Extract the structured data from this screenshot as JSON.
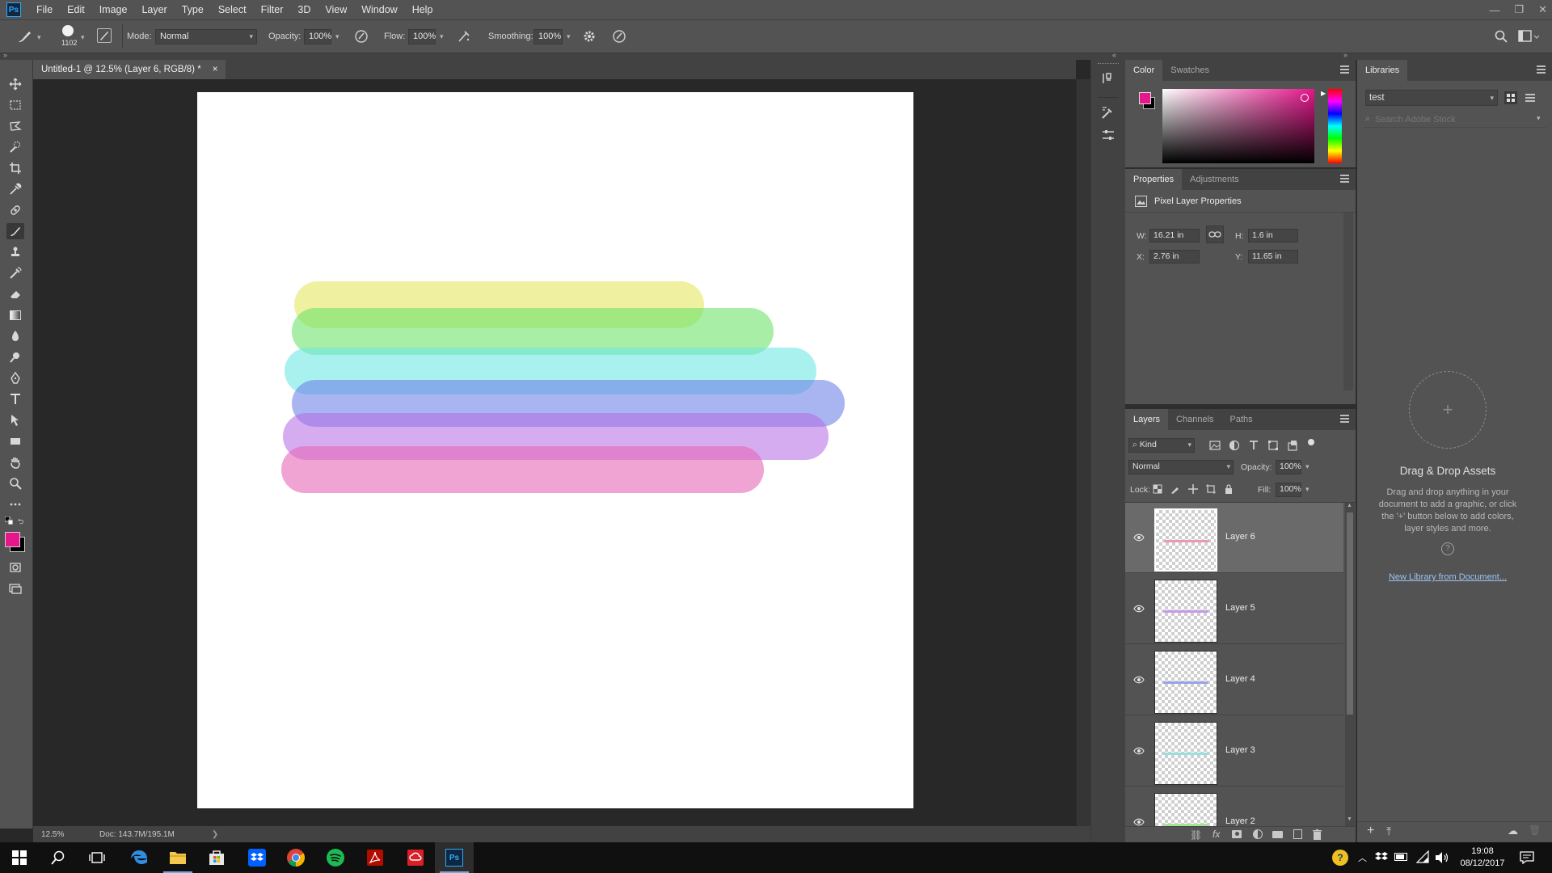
{
  "app": {
    "logo_text": "Ps"
  },
  "menu": [
    "File",
    "Edit",
    "Image",
    "Layer",
    "Type",
    "Select",
    "Filter",
    "3D",
    "View",
    "Window",
    "Help"
  ],
  "options_bar": {
    "brush_size": "1102",
    "mode_label": "Mode:",
    "mode_value": "Normal",
    "opacity_label": "Opacity:",
    "opacity_value": "100%",
    "flow_label": "Flow:",
    "flow_value": "100%",
    "smoothing_label": "Smoothing:",
    "smoothing_value": "100%"
  },
  "document": {
    "tab_title": "Untitled-1 @ 12.5% (Layer 6, RGB/8) *",
    "close_glyph": "×",
    "zoom": "12.5%",
    "doc_info": "Doc: 143.7M/195.1M",
    "strokes": [
      {
        "color": "#e6ea6e",
        "opacity": 0.65
      },
      {
        "color": "#6ee26a",
        "opacity": 0.6
      },
      {
        "color": "#6fe8e2",
        "opacity": 0.6
      },
      {
        "color": "#6f84e6",
        "opacity": 0.6
      },
      {
        "color": "#b468e6",
        "opacity": 0.55
      },
      {
        "color": "#e668b8",
        "opacity": 0.6
      }
    ]
  },
  "color_panel": {
    "tabs": [
      "Color",
      "Swatches"
    ],
    "foreground": "#e6168c",
    "background": "#000000"
  },
  "properties_panel": {
    "tabs": [
      "Properties",
      "Adjustments"
    ],
    "heading": "Pixel Layer Properties",
    "w_label": "W:",
    "w_value": "16.21 in",
    "h_label": "H:",
    "h_value": "1.6 in",
    "x_label": "X:",
    "x_value": "2.76 in",
    "y_label": "Y:",
    "y_value": "11.65 in"
  },
  "layers_panel": {
    "tabs": [
      "Layers",
      "Channels",
      "Paths"
    ],
    "filter_label": "Kind",
    "blend_mode": "Normal",
    "opacity_label": "Opacity:",
    "opacity_value": "100%",
    "lock_label": "Lock:",
    "fill_label": "Fill:",
    "fill_value": "100%",
    "layers": [
      {
        "name": "Layer 6",
        "stroke_color": "#e89ab8",
        "selected": true
      },
      {
        "name": "Layer 5",
        "stroke_color": "#c79ae8",
        "selected": false
      },
      {
        "name": "Layer 4",
        "stroke_color": "#9aa3e8",
        "selected": false
      },
      {
        "name": "Layer 3",
        "stroke_color": "#9ae0e0",
        "selected": false
      },
      {
        "name": "Layer 2",
        "stroke_color": "#a6e39a",
        "selected": false
      }
    ]
  },
  "libraries_panel": {
    "tab": "Libraries",
    "library_name": "test",
    "search_placeholder": "Search Adobe Stock",
    "drop_title": "Drag & Drop Assets",
    "drop_text": "Drag and drop anything in your document to add a graphic, or click the '+' button below to add colors, layer styles and more.",
    "help_glyph": "?",
    "new_library_link": "New Library from Document..."
  },
  "taskbar": {
    "time": "19:08",
    "date": "08/12/2017"
  }
}
